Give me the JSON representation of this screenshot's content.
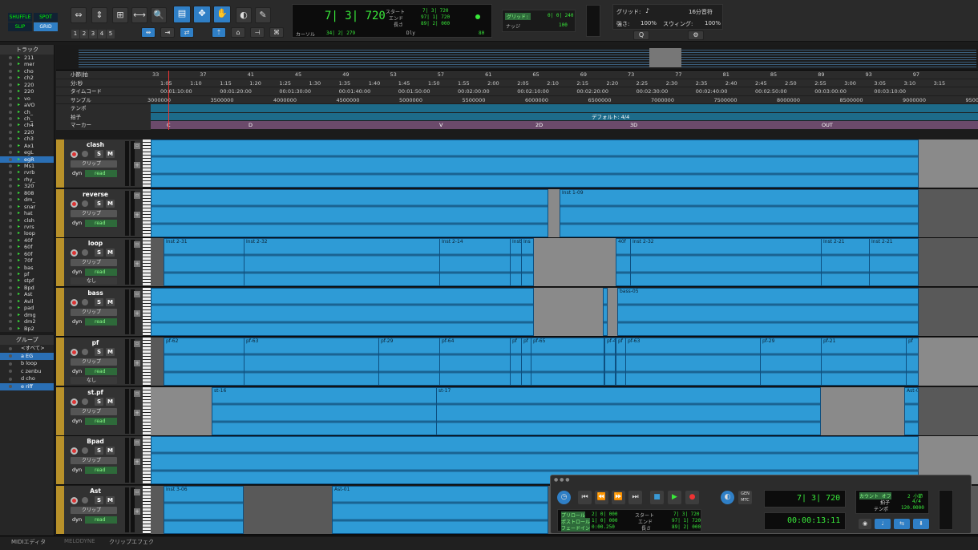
{
  "toolbar": {
    "modes": [
      "SHUFFLE",
      "SPOT",
      "SLIP",
      "GRID"
    ],
    "zoom_presets": [
      "1",
      "2",
      "3",
      "4",
      "5"
    ],
    "counter_main": "7| 3| 720",
    "start_label": "スタート",
    "end_label": "エンド",
    "length_label": "長さ",
    "start": "7| 3| 720",
    "end": "97| 1| 720",
    "length": "89| 2| 000",
    "cursor_label": "カーソル",
    "cursor_value": "34| 2| 279",
    "dly_label": "Dly",
    "tempo_value": "80",
    "grid_label": "グリッド:",
    "grid_value": "16分音符",
    "nudge_label": "ナッジ",
    "nudge_value": "100",
    "grid_small_value": "0| 0| 240",
    "quant_label": "強さ:",
    "quant_value": "100%",
    "swing_label": "スウィング:",
    "swing_value": "100%"
  },
  "tracks_pane": {
    "title": "トラック",
    "items": [
      "211",
      "mer",
      "cho",
      "ch2",
      "220",
      "220",
      "vo",
      "aVO",
      "ch_",
      "ch_",
      "ch4",
      "220",
      "ch3",
      "Ax1",
      "egL",
      "egR",
      "Ms1",
      "rvrb",
      "rhy_",
      "320",
      "808",
      "dm_",
      "snar",
      "hat",
      "clsh",
      "rvrs",
      "loop",
      "40f",
      "60f",
      "60f",
      "70f",
      "bas",
      "pf",
      "stpf",
      "Bpd",
      "Ast",
      "Avil",
      "pad",
      "dmg",
      "dm2",
      "Bp2"
    ],
    "selected_index": 15
  },
  "groups_pane": {
    "title": "グループ",
    "items": [
      "<すべて>",
      "a  EG",
      "b  loop",
      "c  zenbu",
      "d  cho",
      "e  riff"
    ],
    "selected": [
      1,
      5
    ]
  },
  "rulers": {
    "rows": [
      "小節|拍",
      "分:秒",
      "タイムコード",
      "サンプル",
      "テンポ",
      "拍子",
      "マーカー"
    ],
    "bars": [
      "33",
      "37",
      "41",
      "45",
      "49",
      "53",
      "57",
      "61",
      "65",
      "69",
      "73",
      "77",
      "81",
      "85",
      "89",
      "93",
      "97"
    ],
    "minsec": [
      "1:05",
      "1:10",
      "1:15",
      "1:20",
      "1:25",
      "1:30",
      "1:35",
      "1:40",
      "1:45",
      "1:50",
      "1:55",
      "2:00",
      "2:05",
      "2:10",
      "2:15",
      "2:20",
      "2:25",
      "2:30",
      "2:35",
      "2:40",
      "2:45",
      "2:50",
      "2:55",
      "3:00",
      "3:05",
      "3:10",
      "3:15"
    ],
    "timecode": [
      "00:01:10:00",
      "00:01:20:00",
      "00:01:30:00",
      "00:01:40:00",
      "00:01:50:00",
      "00:02:00:00",
      "00:02:10:00",
      "00:02:20:00",
      "00:02:30:00",
      "00:02:40:00",
      "00:02:50:00",
      "00:03:00:00",
      "00:03:10:00"
    ],
    "samples": [
      "3000000",
      "3500000",
      "4000000",
      "4500000",
      "5000000",
      "5500000",
      "6000000",
      "6500000",
      "7000000",
      "7500000",
      "8000000",
      "8500000",
      "9000000",
      "9500"
    ],
    "meter_default": "デフォルト: 4/4",
    "markers": [
      "C",
      "D",
      "V",
      "2D",
      "3D",
      "OUT"
    ]
  },
  "tracks": [
    {
      "name": "clash",
      "clip_label": "クリップ",
      "dyn": "dyn",
      "read": "read",
      "clips": []
    },
    {
      "name": "reverse",
      "clip_label": "クリップ",
      "dyn": "dyn",
      "read": "read",
      "clips": [
        "Inst 1-09"
      ]
    },
    {
      "name": "loop",
      "clip_label": "クリップ",
      "dyn": "dyn",
      "read": "read",
      "extra": "なし",
      "clips": [
        "Inst 2-31",
        "Inst 2-32",
        "Inst 2-14",
        "Inst",
        "Ins",
        "40f",
        "Inst 2-32",
        "Inst 2-21",
        "Inst 2-21"
      ]
    },
    {
      "name": "bass",
      "clip_label": "クリップ",
      "dyn": "dyn",
      "read": "read",
      "clips": [
        "bass-05"
      ]
    },
    {
      "name": "pf",
      "clip_label": "クリップ",
      "dyn": "dyn",
      "read": "read",
      "extra": "なし",
      "clips": [
        "pf-62",
        "pf-63",
        "pf-29",
        "pf-64",
        "pf",
        "pf",
        "pf-65",
        "pf-4",
        "pf",
        "pf-63",
        "pf-29",
        "pf-21",
        "pf"
      ]
    },
    {
      "name": "st.pf",
      "clip_label": "クリップ",
      "dyn": "dyn",
      "read": "read",
      "clips": [
        "st-16",
        "st-17",
        "Ast-03"
      ]
    },
    {
      "name": "Bpad",
      "clip_label": "クリップ",
      "dyn": "dyn",
      "read": "read",
      "clips": []
    },
    {
      "name": "Ast",
      "clip_label": "クリップ",
      "dyn": "dyn",
      "read": "read",
      "clips": [
        "Inst 3-06",
        "Ast-01"
      ]
    }
  ],
  "transport": {
    "counter_main": "7| 3| 720",
    "counter_sub": "00:00:13:11",
    "preroll_label": "プリロール",
    "postroll_label": "ポストロール",
    "fadein_label": "フェードイン",
    "preroll": "2| 0| 000",
    "postroll": "1| 0| 000",
    "fadein": "0:00.250",
    "start_label": "スタート",
    "end_label": "エンド",
    "length_label": "長さ",
    "start": "7| 3| 720",
    "end": "97| 1| 720",
    "length": "89| 2| 000",
    "gen_label": "GEN",
    "mtc_label": "MTC",
    "countoff_label": "カウント オフ",
    "countoff_value": "2 小節",
    "meter_label": "拍子",
    "meter_value": "4/4",
    "tempo_label": "テンポ",
    "tempo_value": "120.0000"
  },
  "bottom_tabs": [
    "MIDIエディタ",
    "MELODYNE",
    "クリップエフェク"
  ],
  "colors": {
    "accent": "#2f7fc6",
    "clip": "#2e9bd6",
    "track_color": "#b8912a",
    "counter_green": "#39e83a"
  }
}
